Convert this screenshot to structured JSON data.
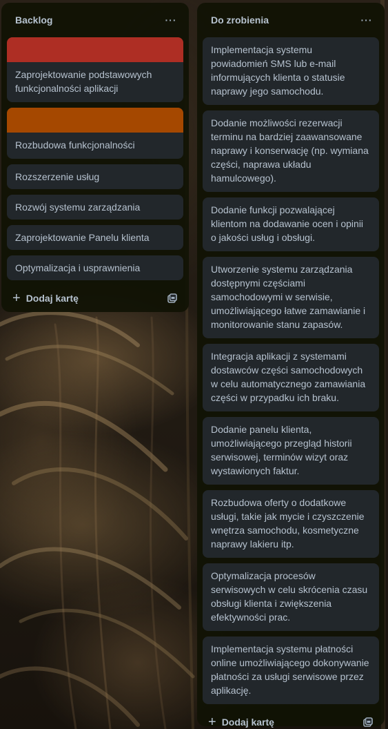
{
  "colors": {
    "list_bg": "#101204",
    "card_bg": "#22272b",
    "text": "#b6c2cf",
    "cover_red": "#ae2e24",
    "cover_orange": "#a54800"
  },
  "icons": {
    "more": "more-dots-icon",
    "add": "plus-icon",
    "template": "card-template-icon"
  },
  "lists": [
    {
      "title": "Backlog",
      "menu_glyph": "···",
      "cards": [
        {
          "cover_color": "#ae2e24",
          "text": "Zaprojektowanie podstawowych funkcjonalności aplikacji"
        },
        {
          "cover_color": "#a54800",
          "text": "Rozbudowa funkcjonalności"
        },
        {
          "text": "Rozszerzenie usług"
        },
        {
          "text": "Rozwój systemu zarządzania"
        },
        {
          "text": "Zaprojektowanie Panelu klienta"
        },
        {
          "text": "Optymalizacja i usprawnienia"
        }
      ],
      "add_card_label": "Dodaj kartę",
      "add_glyph": "+"
    },
    {
      "title": "Do zrobienia",
      "menu_glyph": "···",
      "cards": [
        {
          "text": "Implementacja systemu powiadomień SMS lub e-mail informujących klienta o statusie naprawy jego samochodu."
        },
        {
          "text": "Dodanie możliwości rezerwacji terminu na bardziej zaawansowane naprawy i konserwację (np. wymiana części, naprawa układu hamulcowego)."
        },
        {
          "text": "Dodanie funkcji pozwalającej klientom na dodawanie ocen i opinii o jakości usług i obsługi."
        },
        {
          "text": "Utworzenie systemu zarządzania dostępnymi częściami samochodowymi w serwisie, umożliwiającego łatwe zamawianie i monitorowanie stanu zapasów."
        },
        {
          "text": "Integracja aplikacji z systemami dostawców części samochodowych w celu automatycznego zamawiania części w przypadku ich braku."
        },
        {
          "text": "Dodanie panelu klienta, umożliwiającego przegląd historii serwisowej, terminów wizyt oraz wystawionych faktur."
        },
        {
          "text": "Rozbudowa oferty o dodatkowe usługi, takie jak mycie i czyszczenie wnętrza samochodu, kosmetyczne naprawy lakieru itp."
        },
        {
          "text": "Optymalizacja procesów serwisowych w celu skrócenia czasu obsługi klienta i zwiększenia efektywności prac."
        },
        {
          "text": "Implementacja systemu płatności online umożliwiającego dokonywanie płatności za usługi serwisowe przez aplikację."
        }
      ],
      "add_card_label": "Dodaj kartę",
      "add_glyph": "+"
    }
  ]
}
